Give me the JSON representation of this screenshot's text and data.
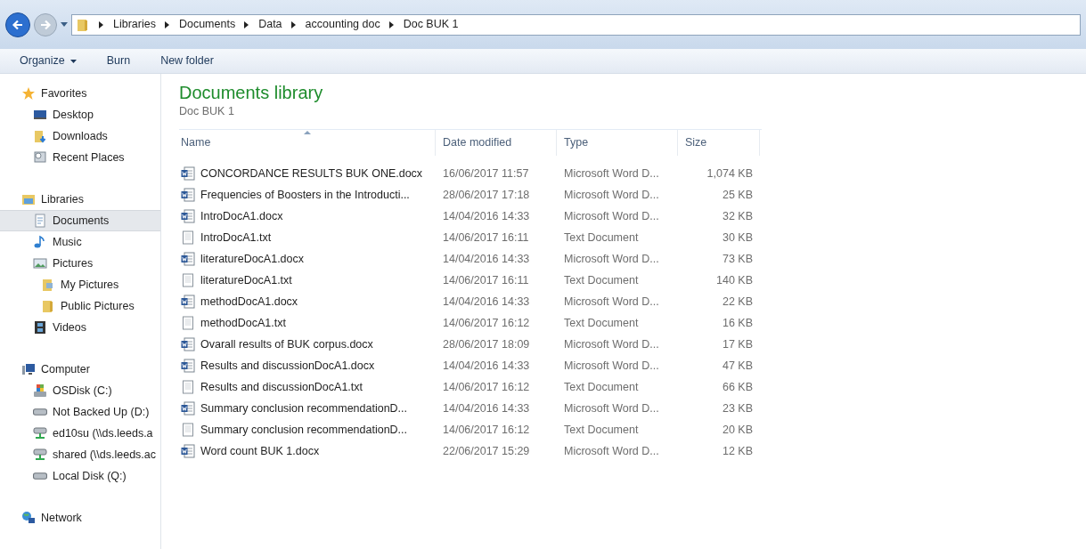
{
  "breadcrumb": [
    "Libraries",
    "Documents",
    "Data",
    "accounting doc",
    "Doc BUK 1"
  ],
  "toolbar": [
    {
      "label": "Organize",
      "dropdown": true
    },
    {
      "label": "Burn",
      "dropdown": false
    },
    {
      "label": "New folder",
      "dropdown": false
    }
  ],
  "sidebar": [
    {
      "label": "Favorites",
      "kind": "star",
      "items": [
        {
          "label": "Desktop",
          "kind": "desktop",
          "selected": false
        },
        {
          "label": "Downloads",
          "kind": "downloads",
          "selected": false
        },
        {
          "label": "Recent Places",
          "kind": "recent",
          "selected": false
        }
      ]
    },
    {
      "label": "Libraries",
      "kind": "library",
      "items": [
        {
          "label": "Documents",
          "kind": "document",
          "selected": true
        },
        {
          "label": "Music",
          "kind": "music",
          "selected": false
        },
        {
          "label": "Pictures",
          "kind": "pictures",
          "selected": false,
          "children": [
            {
              "label": "My Pictures",
              "kind": "folder-pictures",
              "selected": false
            },
            {
              "label": "Public Pictures",
              "kind": "folder",
              "selected": false
            }
          ]
        },
        {
          "label": "Videos",
          "kind": "videos",
          "selected": false
        }
      ]
    },
    {
      "label": "Computer",
      "kind": "computer",
      "items": [
        {
          "label": "OSDisk (C:)",
          "kind": "system-drive",
          "selected": false
        },
        {
          "label": "Not Backed Up (D:)",
          "kind": "drive",
          "selected": false
        },
        {
          "label": "ed10su (\\\\ds.leeds.a",
          "kind": "network-drive",
          "selected": false
        },
        {
          "label": "shared (\\\\ds.leeds.ac",
          "kind": "network-drive",
          "selected": false
        },
        {
          "label": "Local Disk (Q:)",
          "kind": "drive",
          "selected": false
        }
      ]
    },
    {
      "label": "Network",
      "kind": "network"
    }
  ],
  "library": {
    "title": "Documents library",
    "subtitle": "Doc BUK 1"
  },
  "table": {
    "columns": [
      {
        "label": "Name",
        "sorted": true
      },
      {
        "label": "Date modified",
        "sorted": false
      },
      {
        "label": "Type",
        "sorted": false
      },
      {
        "label": "Size",
        "sorted": false
      }
    ],
    "rows": [
      {
        "kind": "word",
        "name": "CONCORDANCE RESULTS BUK ONE.docx",
        "date": "16/06/2017 11:57",
        "type": "Microsoft Word D...",
        "size": "1,074 KB"
      },
      {
        "kind": "word",
        "name": "Frequencies of Boosters in the Introducti...",
        "date": "28/06/2017 17:18",
        "type": "Microsoft Word D...",
        "size": "25 KB"
      },
      {
        "kind": "word",
        "name": "IntroDocA1.docx",
        "date": "14/04/2016 14:33",
        "type": "Microsoft Word D...",
        "size": "32 KB"
      },
      {
        "kind": "text",
        "name": "IntroDocA1.txt",
        "date": "14/06/2017 16:11",
        "type": "Text Document",
        "size": "30 KB"
      },
      {
        "kind": "word",
        "name": "literatureDocA1.docx",
        "date": "14/04/2016 14:33",
        "type": "Microsoft Word D...",
        "size": "73 KB"
      },
      {
        "kind": "text",
        "name": "literatureDocA1.txt",
        "date": "14/06/2017 16:11",
        "type": "Text Document",
        "size": "140 KB"
      },
      {
        "kind": "word",
        "name": "methodDocA1.docx",
        "date": "14/04/2016 14:33",
        "type": "Microsoft Word D...",
        "size": "22 KB"
      },
      {
        "kind": "text",
        "name": "methodDocA1.txt",
        "date": "14/06/2017 16:12",
        "type": "Text Document",
        "size": "16 KB"
      },
      {
        "kind": "word",
        "name": "Ovarall results of BUK corpus.docx",
        "date": "28/06/2017 18:09",
        "type": "Microsoft Word D...",
        "size": "17 KB"
      },
      {
        "kind": "word",
        "name": "Results and discussionDocA1.docx",
        "date": "14/04/2016 14:33",
        "type": "Microsoft Word D...",
        "size": "47 KB"
      },
      {
        "kind": "text",
        "name": "Results and discussionDocA1.txt",
        "date": "14/06/2017 16:12",
        "type": "Text Document",
        "size": "66 KB"
      },
      {
        "kind": "word",
        "name": "Summary conclusion recommendationD...",
        "date": "14/04/2016 14:33",
        "type": "Microsoft Word D...",
        "size": "23 KB"
      },
      {
        "kind": "text",
        "name": "Summary conclusion recommendationD...",
        "date": "14/06/2017 16:12",
        "type": "Text Document",
        "size": "20 KB"
      },
      {
        "kind": "word",
        "name": "Word count BUK 1.docx",
        "date": "22/06/2017 15:29",
        "type": "Microsoft Word D...",
        "size": "12 KB"
      }
    ]
  }
}
